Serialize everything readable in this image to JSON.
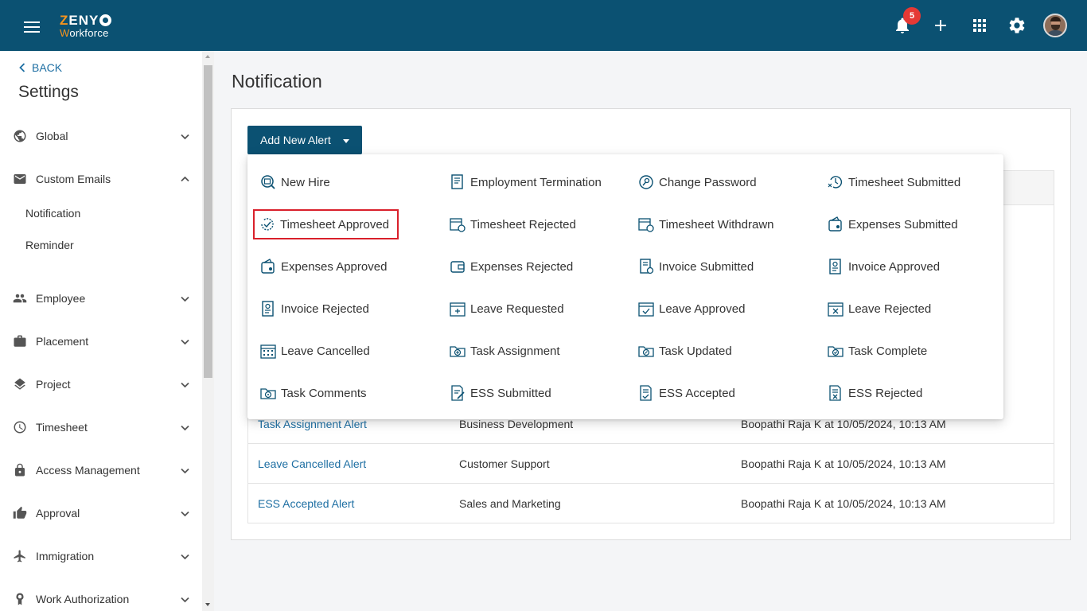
{
  "header": {
    "logo_line1": "ZENYO",
    "logo_line2": "Workforce",
    "notification_count": "5"
  },
  "sidebar": {
    "back_label": "BACK",
    "title": "Settings",
    "items": [
      {
        "label": "Global",
        "icon": "globe-icon"
      },
      {
        "label": "Custom Emails",
        "icon": "mail-icon",
        "expanded": true
      },
      {
        "label": "Employee",
        "icon": "people-icon"
      },
      {
        "label": "Placement",
        "icon": "briefcase-icon"
      },
      {
        "label": "Project",
        "icon": "layers-icon"
      },
      {
        "label": "Timesheet",
        "icon": "clock-icon"
      },
      {
        "label": "Access Management",
        "icon": "lock-icon"
      },
      {
        "label": "Approval",
        "icon": "thumbs-up-icon"
      },
      {
        "label": "Immigration",
        "icon": "airplane-icon"
      },
      {
        "label": "Work Authorization",
        "icon": "badge-icon"
      }
    ],
    "sub_items": [
      "Notification",
      "Reminder"
    ]
  },
  "main": {
    "title": "Notification",
    "add_button": "Add New Alert",
    "table_rows": [
      {
        "name": "Task Assignment Alert",
        "department": "Business Development",
        "modified": "Boopathi Raja K at 10/05/2024, 10:13 AM"
      },
      {
        "name": "Leave Cancelled Alert",
        "department": "Customer Support",
        "modified": "Boopathi Raja K at 10/05/2024, 10:13 AM"
      },
      {
        "name": "ESS Accepted Alert",
        "department": "Sales and Marketing",
        "modified": "Boopathi Raja K at 10/05/2024, 10:13 AM"
      }
    ]
  },
  "dropdown": {
    "items": [
      [
        "New Hire",
        "Employment Termination",
        "Change Password",
        "Timesheet Submitted"
      ],
      [
        "Timesheet Approved",
        "Timesheet Rejected",
        "Timesheet Withdrawn",
        "Expenses Submitted"
      ],
      [
        "Expenses Approved",
        "Expenses Rejected",
        "Invoice Submitted",
        "Invoice Approved"
      ],
      [
        "Invoice Rejected",
        "Leave Requested",
        "Leave Approved",
        "Leave Rejected"
      ],
      [
        "Leave Cancelled",
        "Task Assignment",
        "Task Updated",
        "Task Complete"
      ],
      [
        "Task Comments",
        "ESS Submitted",
        "ESS Accepted",
        "ESS Rejected"
      ]
    ],
    "highlighted": "Timesheet Approved"
  },
  "colors": {
    "brand": "#0b5172",
    "accent": "#f7941d",
    "link": "#1e6fa3",
    "highlight_border": "#d9202b",
    "badge": "#e53935"
  }
}
